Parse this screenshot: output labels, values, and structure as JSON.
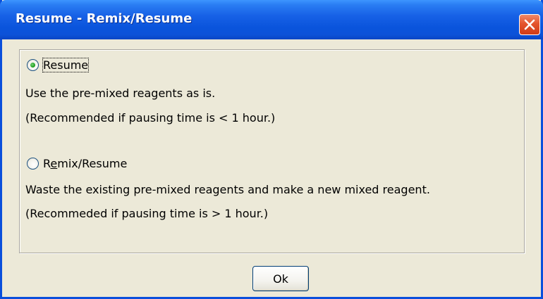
{
  "window": {
    "title": "Resume - Remix/Resume",
    "accent_color": "#0a54dc",
    "close_icon": "close-icon"
  },
  "options": [
    {
      "label": "Resume",
      "selected": true,
      "description": "Use the pre-mixed reagents as is.",
      "note": "(Recommended if pausing time is < 1 hour.)"
    },
    {
      "label_prefix": "R",
      "label_mnemonic": "e",
      "label_suffix": "mix/Resume",
      "selected": false,
      "description": "Waste the existing pre-mixed reagents and make a new mixed reagent.",
      "note": "(Recommeded if pausing time is > 1 hour.)"
    }
  ],
  "buttons": {
    "ok_label": "Ok"
  }
}
